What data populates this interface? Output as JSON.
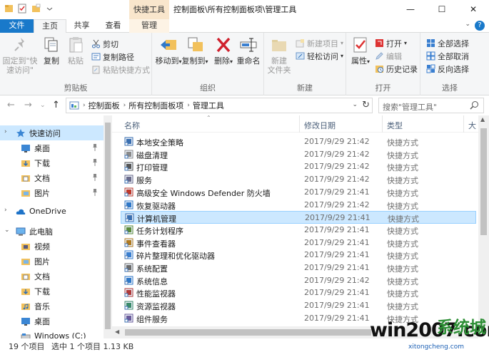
{
  "window": {
    "title": "控制面板\\所有控制面板项\\管理工具",
    "context_tab_header": "快捷工具",
    "buttons": [
      "—",
      "☐",
      "✕"
    ]
  },
  "ribbon_tabs": {
    "file": "文件",
    "home": "主页",
    "share": "共享",
    "view": "查看",
    "manage": "管理"
  },
  "ribbon": {
    "clipboard": {
      "pin": "固定到\"快速访问\"",
      "copy": "复制",
      "paste": "粘贴",
      "cut": "剪切",
      "copy_path": "复制路径",
      "paste_shortcut": "粘贴快捷方式",
      "label": "剪贴板"
    },
    "organize": {
      "move_to": "移动到",
      "copy_to": "复制到",
      "delete": "删除",
      "rename": "重命名",
      "label": "组织"
    },
    "new": {
      "new_folder": "新建\n文件夹",
      "new_item": "新建项目",
      "easy_access": "轻松访问",
      "label": "新建"
    },
    "open": {
      "properties": "属性",
      "open": "打开",
      "edit": "编辑",
      "history": "历史记录",
      "label": "打开"
    },
    "select": {
      "select_all": "全部选择",
      "select_none": "全部取消",
      "invert": "反向选择",
      "label": "选择"
    }
  },
  "address": {
    "crumbs": [
      "控制面板",
      "所有控制面板项",
      "管理工具"
    ],
    "search_placeholder": "搜索\"管理工具\""
  },
  "nav": {
    "items": [
      {
        "label": "快速访问",
        "icon": "star-icon",
        "pinned": false
      },
      {
        "label": "桌面",
        "icon": "desktop-icon",
        "pinned": true
      },
      {
        "label": "下载",
        "icon": "download-icon",
        "pinned": true
      },
      {
        "label": "文档",
        "icon": "document-icon",
        "pinned": true
      },
      {
        "label": "图片",
        "icon": "picture-icon",
        "pinned": true
      },
      {
        "label": "OneDrive",
        "icon": "cloud-icon",
        "pinned": false
      },
      {
        "label": "此电脑",
        "icon": "computer-icon",
        "pinned": false
      },
      {
        "label": "视频",
        "icon": "video-icon",
        "pinned": false
      },
      {
        "label": "图片",
        "icon": "picture-icon",
        "pinned": false
      },
      {
        "label": "文档",
        "icon": "document-icon",
        "pinned": false
      },
      {
        "label": "下载",
        "icon": "download-icon",
        "pinned": false
      },
      {
        "label": "音乐",
        "icon": "music-icon",
        "pinned": false
      },
      {
        "label": "桌面",
        "icon": "desktop-icon",
        "pinned": false
      },
      {
        "label": "Windows (C:)",
        "icon": "drive-icon",
        "pinned": false
      }
    ]
  },
  "filelist": {
    "columns": {
      "name": "名称",
      "date": "修改日期",
      "type": "类型",
      "size": "大"
    },
    "rows": [
      {
        "name": "本地安全策略",
        "date": "2017/9/29 21:42",
        "type": "快捷方式"
      },
      {
        "name": "磁盘清理",
        "date": "2017/9/29 21:42",
        "type": "快捷方式"
      },
      {
        "name": "打印管理",
        "date": "2017/9/29 21:42",
        "type": "快捷方式"
      },
      {
        "name": "服务",
        "date": "2017/9/29 21:42",
        "type": "快捷方式"
      },
      {
        "name": "高级安全 Windows Defender 防火墙",
        "date": "2017/9/29 21:41",
        "type": "快捷方式"
      },
      {
        "name": "恢复驱动器",
        "date": "2017/9/29 21:42",
        "type": "快捷方式"
      },
      {
        "name": "计算机管理",
        "date": "2017/9/29 21:41",
        "type": "快捷方式"
      },
      {
        "name": "任务计划程序",
        "date": "2017/9/29 21:41",
        "type": "快捷方式"
      },
      {
        "name": "事件查看器",
        "date": "2017/9/29 21:41",
        "type": "快捷方式"
      },
      {
        "name": "碎片整理和优化驱动器",
        "date": "2017/9/29 21:41",
        "type": "快捷方式"
      },
      {
        "name": "系统配置",
        "date": "2017/9/29 21:41",
        "type": "快捷方式"
      },
      {
        "name": "系统信息",
        "date": "2017/9/29 21:42",
        "type": "快捷方式"
      },
      {
        "name": "性能监视器",
        "date": "2017/9/29 21:41",
        "type": "快捷方式"
      },
      {
        "name": "资源监视器",
        "date": "2017/9/29 21:41",
        "type": "快捷方式"
      },
      {
        "name": "组件服务",
        "date": "2017/9/29 21:41",
        "type": "快捷方式"
      }
    ],
    "selected_row": 6
  },
  "status": {
    "count": "19 个项目",
    "selected": "选中 1 个项目  1.13 KB"
  },
  "watermark": {
    "text": "win2007.com",
    "cn_text": "系统城",
    "url": "xitongcheng.com"
  }
}
